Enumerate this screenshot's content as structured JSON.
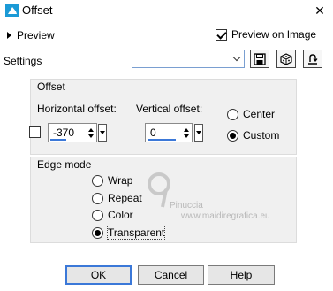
{
  "window": {
    "title": "Offset",
    "close_glyph": "✕"
  },
  "preview": {
    "label": "Preview",
    "preview_on_image_label": "Preview on Image",
    "preview_on_image_checked": true
  },
  "settings": {
    "label": "Settings",
    "preset_value": ""
  },
  "offset": {
    "legend": "Offset",
    "horizontal_label": "Horizontal offset:",
    "horizontal_value": "-370",
    "vertical_label": "Vertical offset:",
    "vertical_value": "0",
    "center_label": "Center",
    "custom_label": "Custom",
    "selected": "Custom"
  },
  "edge_mode": {
    "legend": "Edge mode",
    "options": [
      "Wrap",
      "Repeat",
      "Color",
      "Transparent"
    ],
    "selected": "Transparent"
  },
  "buttons": {
    "ok": "OK",
    "cancel": "Cancel",
    "help": "Help"
  },
  "watermark": {
    "line1": "Pinuccia",
    "line2": "www.maidiregrafica.eu"
  }
}
